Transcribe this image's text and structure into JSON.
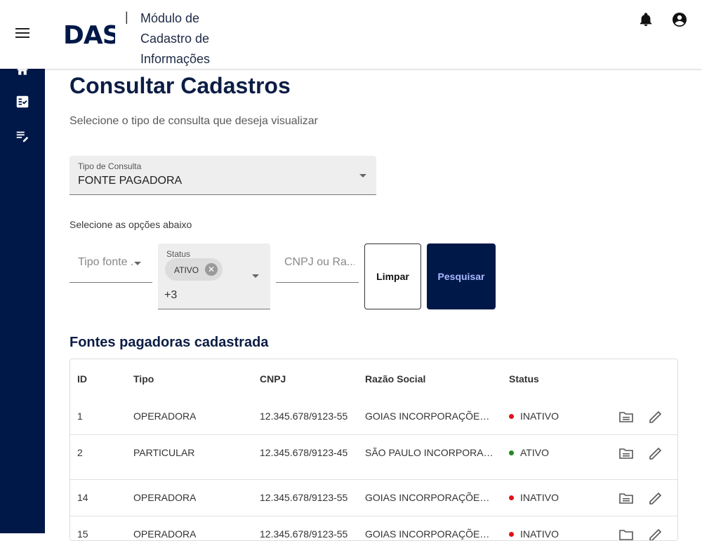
{
  "header": {
    "logo_text": "DASA",
    "module_title": "Módulo de Cadastro de Informações"
  },
  "sidebar": {
    "items": [
      {
        "icon": "home-icon"
      },
      {
        "icon": "checklist-icon"
      },
      {
        "icon": "edit-list-icon"
      }
    ]
  },
  "page": {
    "title": "Consultar Cadastros",
    "subtitle": "Selecione o tipo de consulta que deseja visualizar"
  },
  "consult_type": {
    "label": "Tipo de Consulta",
    "value": "FONTE PAGADORA"
  },
  "filters": {
    "section_label": "Selecione as opções abaixo",
    "tipo_fonte_placeholder": "Tipo fonte ...",
    "status_label": "Status",
    "status_chip": "ATIVO",
    "status_more": "+3",
    "cnpj_placeholder": "CNPJ ou Ra...",
    "clear_label": "Limpar",
    "search_label": "Pesquisar"
  },
  "table": {
    "title": "Fontes pagadoras cadastrada",
    "headers": [
      "ID",
      "Tipo",
      "CNPJ",
      "Razão Social",
      "Status"
    ],
    "rows": [
      {
        "id": "1",
        "tipo": "OPERADORA",
        "cnpj": "12.345.678/9123-55",
        "razao": "GOIAS INCORPORAÇÕES L...",
        "status": "INATIVO",
        "status_color": "#e0101a"
      },
      {
        "id": "2",
        "tipo": "PARTICULAR",
        "cnpj": "12.345.678/9123-45",
        "razao": "SÃO PAULO INCORPORAÇ...",
        "status": "ATIVO",
        "status_color": "#1f8a1f"
      },
      {
        "id": "14",
        "tipo": "OPERADORA",
        "cnpj": "12.345.678/9123-55",
        "razao": "GOIAS INCORPORAÇÕES L...",
        "status": "INATIVO",
        "status_color": "#e0101a"
      },
      {
        "id": "15",
        "tipo": "OPERADORA",
        "cnpj": "12.345.678/9123-55",
        "razao": "GOIAS INCORPORAÇÕES L...",
        "status": "INATIVO",
        "status_color": "#e0101a"
      }
    ]
  },
  "colors": {
    "navy": "#001848",
    "search_button_text": "#a9b8ff",
    "inactive": "#e0101a",
    "active": "#1f8a1f"
  }
}
